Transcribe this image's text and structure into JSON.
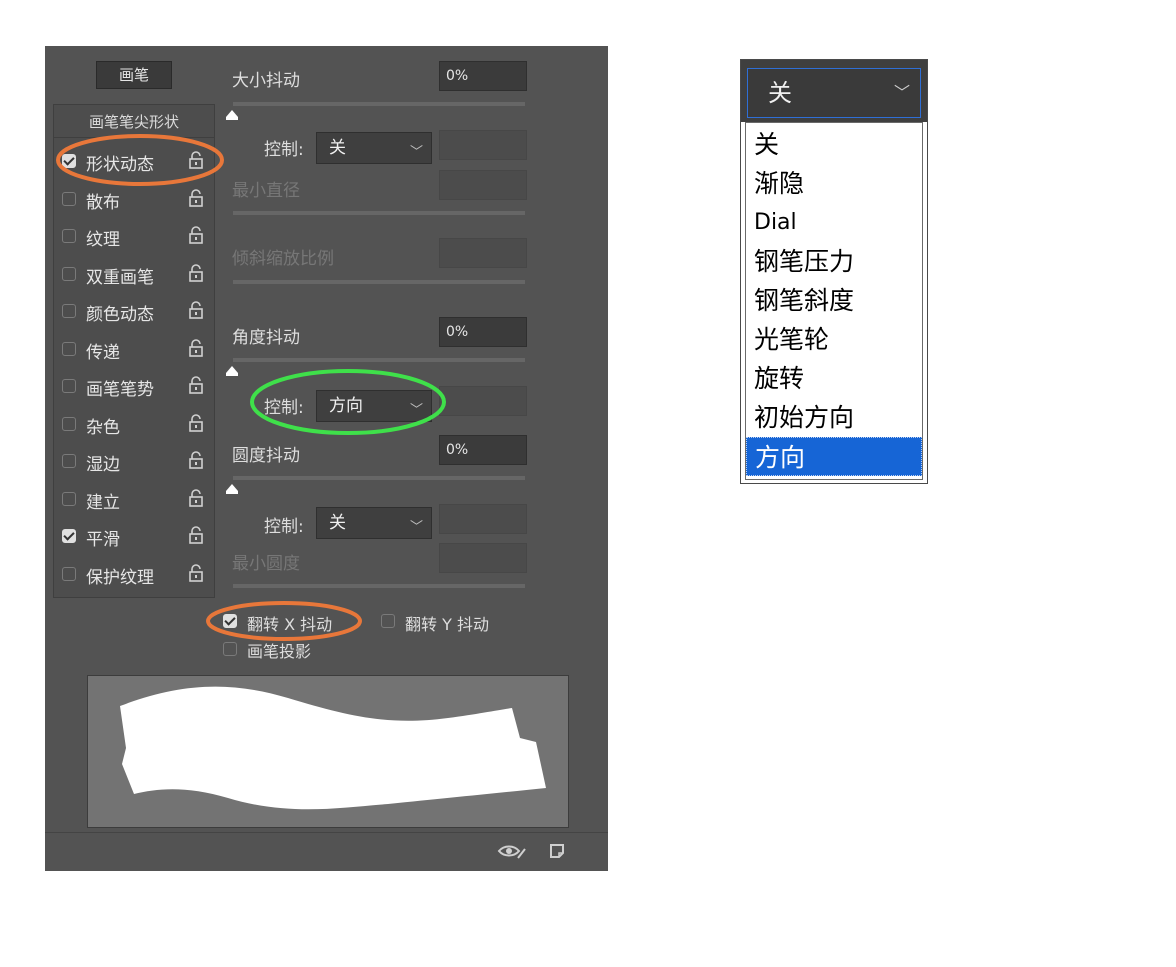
{
  "panel": {
    "tab_label": "画笔",
    "sidebar_header": "画笔笔尖形状",
    "sidebar_items": [
      {
        "label": "形状动态",
        "checked": true
      },
      {
        "label": "散布",
        "checked": false
      },
      {
        "label": "纹理",
        "checked": false
      },
      {
        "label": "双重画笔",
        "checked": false
      },
      {
        "label": "颜色动态",
        "checked": false
      },
      {
        "label": "传递",
        "checked": false
      },
      {
        "label": "画笔笔势",
        "checked": false
      },
      {
        "label": "杂色",
        "checked": false
      },
      {
        "label": "湿边",
        "checked": false
      },
      {
        "label": "建立",
        "checked": false
      },
      {
        "label": "平滑",
        "checked": true
      },
      {
        "label": "保护纹理",
        "checked": false
      }
    ],
    "size_jitter": {
      "label": "大小抖动",
      "value": "0%"
    },
    "control1": {
      "label": "控制:",
      "value": "关"
    },
    "min_diameter": {
      "label": "最小直径"
    },
    "tilt_scale": {
      "label": "倾斜缩放比例"
    },
    "angle_jitter": {
      "label": "角度抖动",
      "value": "0%"
    },
    "control2": {
      "label": "控制:",
      "value": "方向"
    },
    "roundness_jitter": {
      "label": "圆度抖动",
      "value": "0%"
    },
    "control3": {
      "label": "控制:",
      "value": "关"
    },
    "min_roundness": {
      "label": "最小圆度"
    },
    "flip_x": {
      "label": "翻转 X 抖动",
      "checked": true
    },
    "flip_y": {
      "label": "翻转 Y 抖动",
      "checked": false
    },
    "brush_projection": {
      "label": "画笔投影",
      "checked": false
    },
    "colors": {
      "panel_bg": "#535353",
      "annotation_orange": "#e8773a",
      "annotation_green": "#3fe04a"
    }
  },
  "dropdown": {
    "selected_label": "关",
    "options": [
      "关",
      "渐隐",
      "Dial",
      "钢笔压力",
      "钢笔斜度",
      "光笔轮",
      "旋转",
      "初始方向",
      "方向"
    ],
    "highlighted": "方向",
    "highlight_color": "#1665d6"
  }
}
